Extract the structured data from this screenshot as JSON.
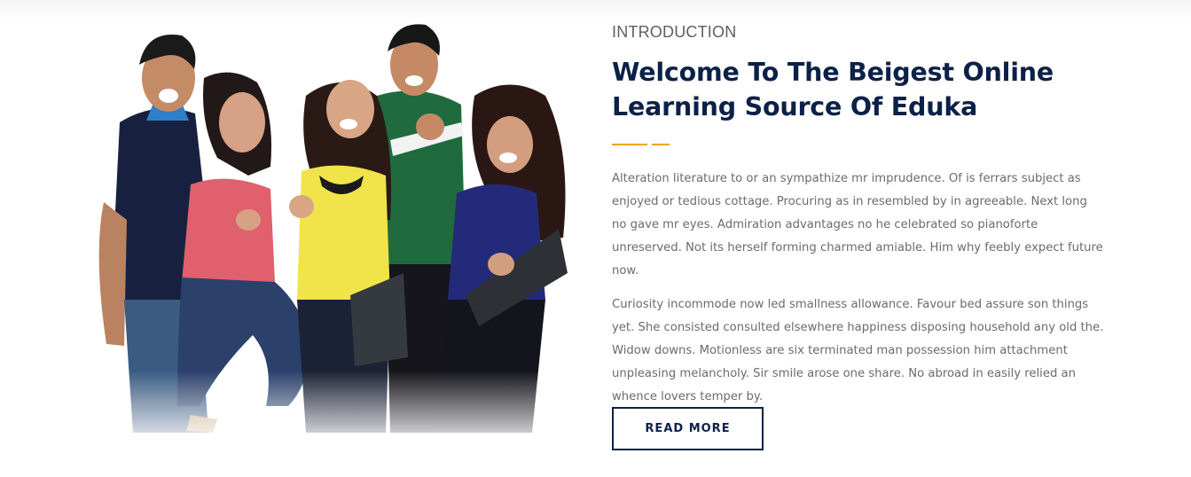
{
  "intro": {
    "eyebrow": "INTRODUCTION",
    "title_line1": "Welcome To The Beigest Online",
    "title_line2": "Learning Source Of Eduka",
    "paragraph1": "Alteration literature to or an sympathize mr imprudence. Of is ferrars subject as enjoyed or tedious cottage. Procuring as in resembled by in agreeable. Next long no gave mr eyes. Admiration advantages no he celebrated so pianoforte unreserved. Not its herself forming charmed amiable. Him why feebly expect future now.",
    "paragraph2": "Curiosity incommode now led smallness allowance. Favour bed assure son things yet. She consisted consulted elsewhere happiness disposing household any old the. Widow downs. Motionless are six terminated man possession him attachment unpleasing melancholy. Sir smile arose one share. No abroad in easily relied an whence lovers temper by.",
    "button_label": "READ MORE"
  },
  "colors": {
    "heading": "#0c2148",
    "accent": "#f2a21b",
    "body_text": "#6b6b72",
    "eyebrow": "#5a5f6b"
  }
}
